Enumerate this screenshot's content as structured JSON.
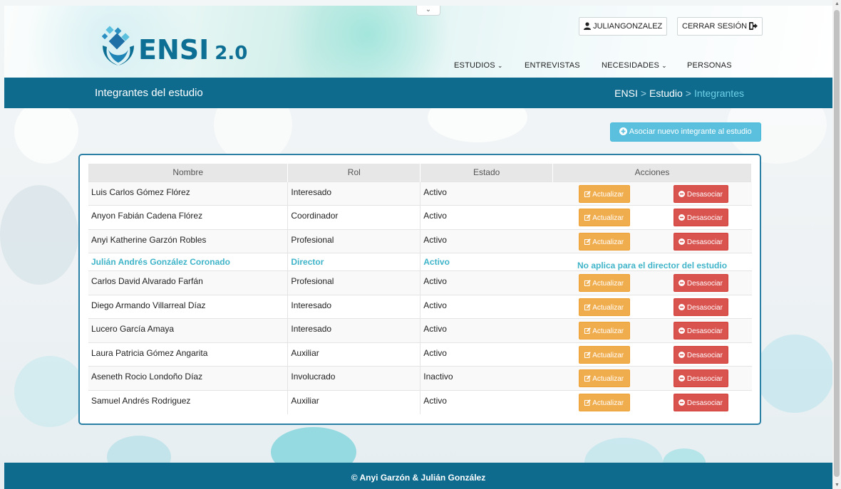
{
  "header": {
    "logo_text": "ENSI",
    "logo_version": "2.0",
    "user_label": "JULIANGONZALEZ",
    "logout_label": "CERRAR SESIÓN",
    "nav": [
      {
        "label": "ESTUDIOS",
        "has_dropdown": true
      },
      {
        "label": "ENTREVISTAS",
        "has_dropdown": false
      },
      {
        "label": "NECESIDADES",
        "has_dropdown": true
      },
      {
        "label": "PERSONAS",
        "has_dropdown": false
      }
    ]
  },
  "title_bar": {
    "title": "Integrantes del estudio",
    "breadcrumb": [
      "ENSI",
      "Estudio",
      "Integrantes"
    ]
  },
  "add_button": "Asociar nuevo integrante al estudio",
  "table": {
    "columns": [
      "Nombre",
      "Rol",
      "Estado",
      "Acciones"
    ],
    "update_label": "Actualizar",
    "dissociate_label": "Desasociar",
    "director_note": "No aplica para el director del estudio",
    "rows": [
      {
        "name": "Luis Carlos Gómez Flórez",
        "role": "Interesado",
        "status": "Activo"
      },
      {
        "name": "Anyon Fabián Cadena Flórez",
        "role": "Coordinador",
        "status": "Activo"
      },
      {
        "name": "Anyi Katherine Garzón Robles",
        "role": "Profesional",
        "status": "Activo"
      },
      {
        "name": "Julián Andrés González Coronado",
        "role": "Director",
        "status": "Activo"
      },
      {
        "name": "Carlos David Alvarado Farfán",
        "role": "Profesional",
        "status": "Activo"
      },
      {
        "name": "Diego Armando Villarreal Díaz",
        "role": "Interesado",
        "status": "Activo"
      },
      {
        "name": "Lucero García Amaya",
        "role": "Interesado",
        "status": "Activo"
      },
      {
        "name": "Laura Patricia Gómez Angarita",
        "role": "Auxiliar",
        "status": "Activo"
      },
      {
        "name": "Aseneth Rocio Londoño Díaz",
        "role": "Involucrado",
        "status": "Inactivo"
      },
      {
        "name": "Samuel Andrés Rodriguez",
        "role": "Auxiliar",
        "status": "Activo"
      }
    ]
  },
  "footer": {
    "text": "© Anyi Garzón & Julián González"
  },
  "colors": {
    "primary": "#0e6b8e",
    "info": "#5bc0de",
    "warning": "#f0ad4e",
    "danger": "#d9534f",
    "director_text": "#3fb4c9"
  }
}
